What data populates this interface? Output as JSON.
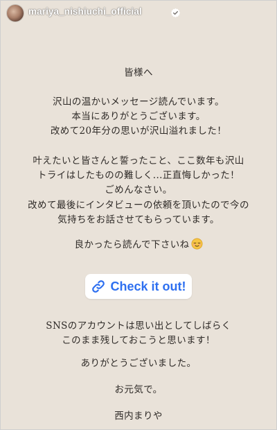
{
  "header": {
    "username": "mariya_nishiuchi_official",
    "avatar_icon": "profile-photo",
    "verified_icon": "verified-badge-icon"
  },
  "message": {
    "block1": [
      "皆様へ"
    ],
    "block2": [
      "沢山の温かいメッセージ読んでいます。",
      "本当にありがとうございます。",
      "改めて20年分の思いが沢山溢れました！"
    ],
    "block3": [
      "叶えたいと皆さんと誓ったこと、ここ数年も沢山",
      "トライはしたものの難しく...正直悔しかった！",
      "ごめんなさい。"
    ],
    "block4": [
      "改めて最後にインタビューの依頼を頂いたので今の",
      "気持ちをお話させてもらっています。"
    ],
    "block5": [
      "良かったら読んで下さいね"
    ],
    "block5_emoji": "relieved-face-emoji",
    "block6": [
      "SNSのアカウントは思い出としてしばらく",
      "このまま残しておこうと思います！"
    ],
    "block7": [
      "ありがとうございました。"
    ],
    "block8": [
      "お元気で。"
    ],
    "block9": [
      "西内まりや"
    ]
  },
  "link_sticker": {
    "label": "Check it out!",
    "icon": "link-icon",
    "color": "#2d6ff0"
  },
  "colors": {
    "background": "#e9e2d9",
    "text": "#2f2b28"
  }
}
